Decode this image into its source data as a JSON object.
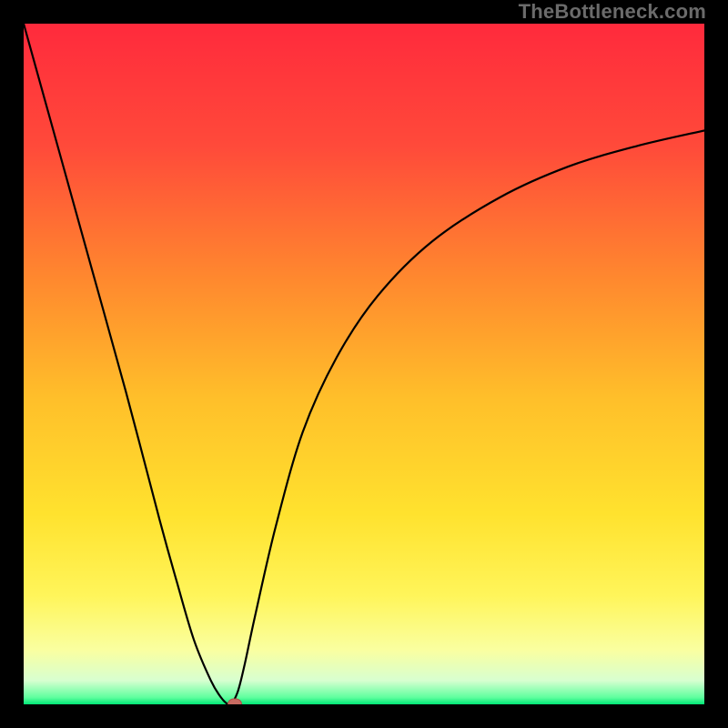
{
  "watermark": "TheBottleneck.com",
  "colors": {
    "frame": "#000000",
    "curve": "#000000",
    "dot_fill": "#c86a61",
    "dot_border": "#b04f47",
    "gradient_stops": [
      {
        "offset": 0.0,
        "color": "#ff2a3c"
      },
      {
        "offset": 0.18,
        "color": "#ff4a3a"
      },
      {
        "offset": 0.38,
        "color": "#ff8a2e"
      },
      {
        "offset": 0.55,
        "color": "#ffbf2a"
      },
      {
        "offset": 0.72,
        "color": "#ffe22e"
      },
      {
        "offset": 0.84,
        "color": "#fff55a"
      },
      {
        "offset": 0.92,
        "color": "#faffa0"
      },
      {
        "offset": 0.965,
        "color": "#d8ffd0"
      },
      {
        "offset": 0.99,
        "color": "#5eff9e"
      },
      {
        "offset": 1.0,
        "color": "#00e676"
      }
    ]
  },
  "chart_data": {
    "type": "line",
    "title": "",
    "xlabel": "",
    "ylabel": "",
    "xlim": [
      0,
      1
    ],
    "ylim": [
      0,
      1
    ],
    "grid": false,
    "series": [
      {
        "name": "bottleneck-curve",
        "x": [
          0.0,
          0.05,
          0.1,
          0.15,
          0.2,
          0.225,
          0.25,
          0.275,
          0.29,
          0.3,
          0.305,
          0.315,
          0.325,
          0.34,
          0.37,
          0.41,
          0.46,
          0.52,
          0.6,
          0.7,
          0.8,
          0.9,
          1.0
        ],
        "y": [
          1.0,
          0.82,
          0.64,
          0.46,
          0.27,
          0.18,
          0.095,
          0.035,
          0.01,
          0.0,
          0.0,
          0.02,
          0.06,
          0.13,
          0.26,
          0.4,
          0.51,
          0.6,
          0.68,
          0.745,
          0.79,
          0.82,
          0.843
        ]
      }
    ],
    "marker": {
      "x": 0.31,
      "y": 0.0
    }
  }
}
